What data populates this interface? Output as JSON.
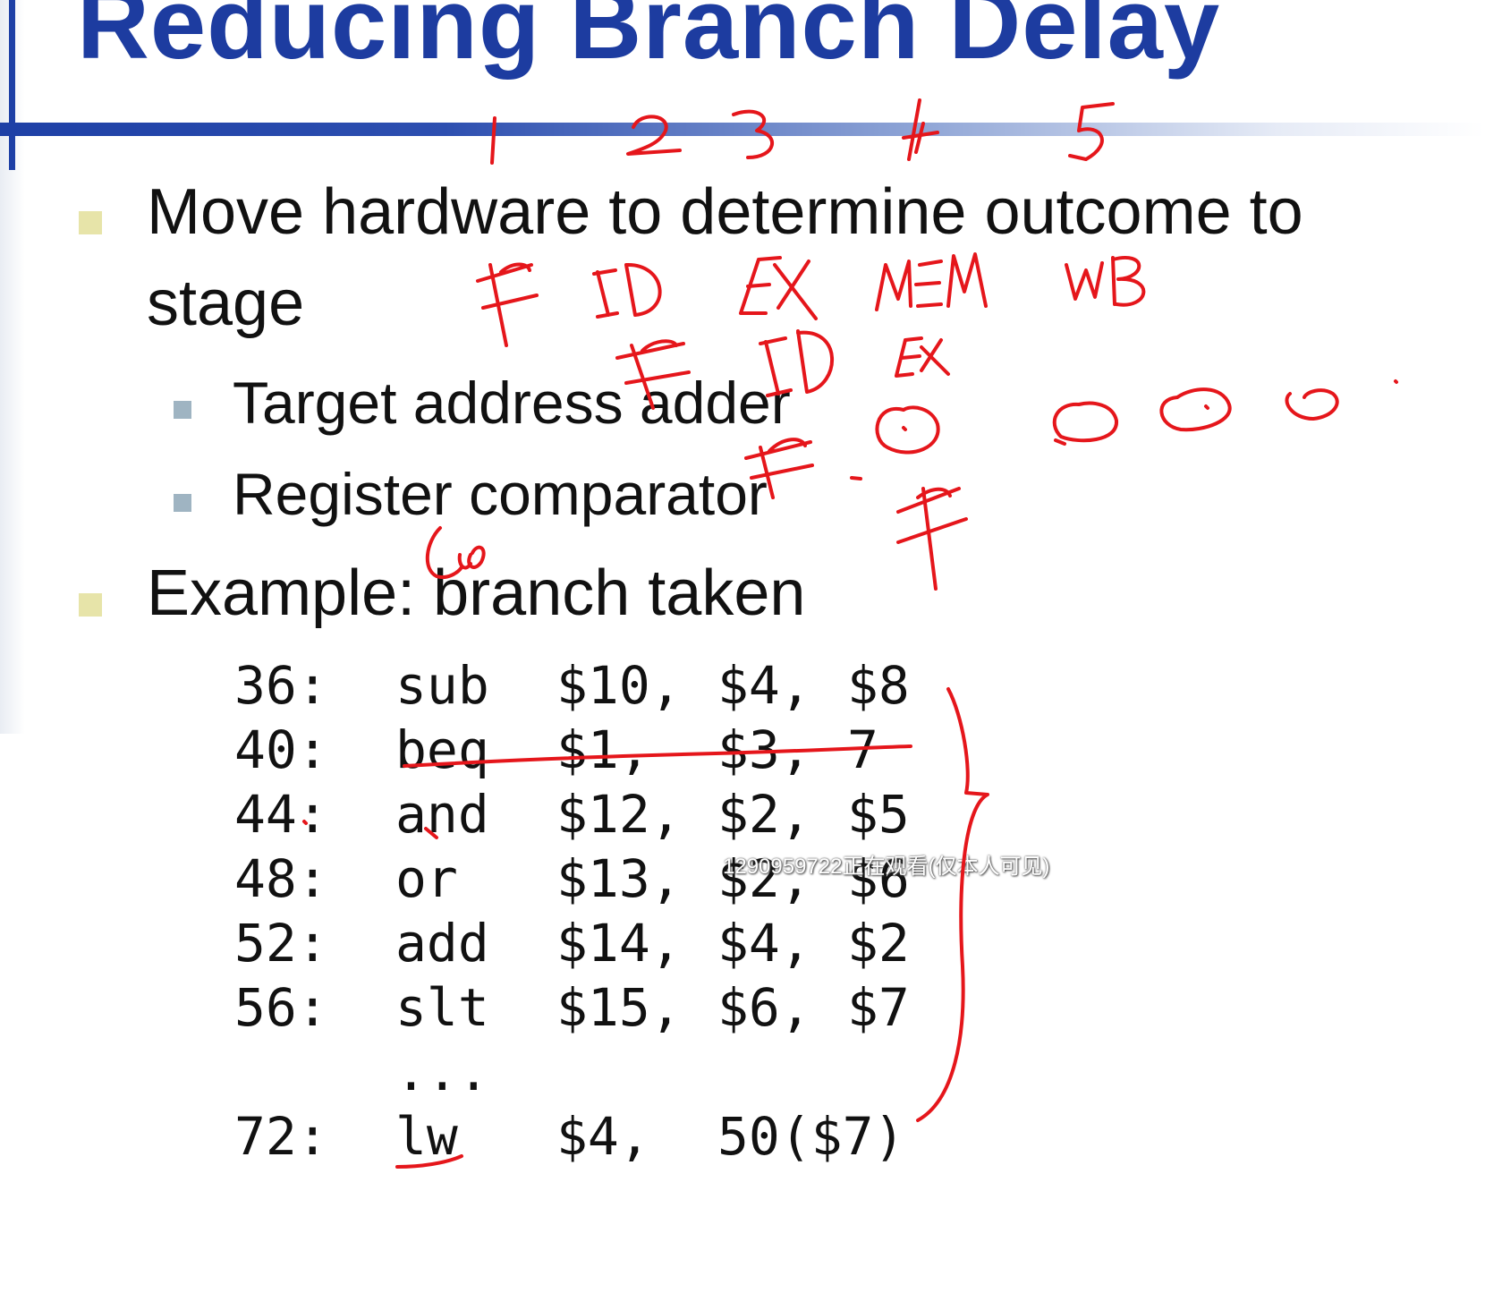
{
  "slide": {
    "title": "Reducing Branch Delay",
    "bullets": [
      {
        "line1": "Move hardware to determine outcome to",
        "line2": "stage"
      },
      {
        "text": "Example: branch taken"
      }
    ],
    "sub_bullets": [
      "Target address adder",
      "Register comparator"
    ],
    "code": [
      {
        "addr": "36:",
        "op": "sub",
        "a1": "$10,",
        "a2": "$4,",
        "a3": "$8"
      },
      {
        "addr": "40:",
        "op": "beq",
        "a1": "$1,",
        "a2": "$3,",
        "a3": "7"
      },
      {
        "addr": "44:",
        "op": "and",
        "a1": "$12,",
        "a2": "$2,",
        "a3": "$5"
      },
      {
        "addr": "48:",
        "op": "or",
        "a1": "$13,",
        "a2": "$2,",
        "a3": "$6"
      },
      {
        "addr": "52:",
        "op": "add",
        "a1": "$14,",
        "a2": "$4,",
        "a3": "$2"
      },
      {
        "addr": "56:",
        "op": "slt",
        "a1": "$15,",
        "a2": "$6,",
        "a3": "$7"
      },
      {
        "addr": "",
        "op": "...",
        "a1": "",
        "a2": "",
        "a3": ""
      },
      {
        "addr": "72:",
        "op": "lw",
        "a1": "$4,",
        "a2": "50($7)",
        "a3": ""
      }
    ],
    "watermark": "1290959722正在观看(仅本人可见)"
  },
  "colors": {
    "title": "#1d3ca0",
    "title_rule": "#1e40a6",
    "bullet_level1": "#e7e4a9",
    "bullet_level2": "#9fb4c2",
    "body_text": "#111111",
    "annotation_ink": "#e5161b"
  },
  "annotations": {
    "stage_numbers": [
      "1",
      "2",
      "3",
      "4",
      "5"
    ],
    "pipeline_row1": [
      "IF",
      "ID",
      "EX",
      "MEM",
      "WB"
    ],
    "pipeline_row2": [
      "IF",
      "ID",
      "EX"
    ],
    "pipeline_row3": [
      "IF"
    ],
    "pipeline_row4": [
      "IF"
    ],
    "note_near_example": "Lw"
  }
}
